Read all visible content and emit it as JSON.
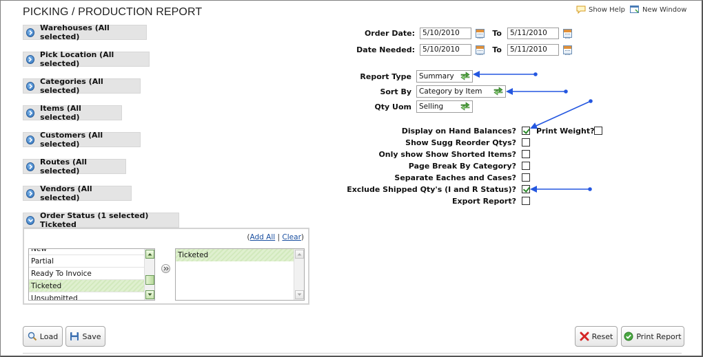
{
  "header": {
    "title": "PICKING / PRODUCTION REPORT",
    "show_help": "Show Help",
    "new_window": "New Window"
  },
  "sections": [
    {
      "label": "Warehouses (All selected)"
    },
    {
      "label": "Pick Location (All selected)"
    },
    {
      "label": "Categories (All selected)"
    },
    {
      "label": "Items (All selected)"
    },
    {
      "label": "Customers (All selected)"
    },
    {
      "label": "Routes (All selected)"
    },
    {
      "label": "Vendors (All selected)"
    },
    {
      "label": "Order Status (1 selected) Ticketed"
    }
  ],
  "order_status": {
    "add_all": "Add All",
    "clear": "Clear",
    "available": [
      "New",
      "Partial",
      "Ready To Invoice",
      "Ticketed",
      "Unsubmitted"
    ],
    "selected": [
      "Ticketed"
    ]
  },
  "dates": {
    "order_date_label": "Order Date:",
    "date_needed_label": "Date Needed:",
    "to_label": "To",
    "order_from": "5/10/2010",
    "order_to": "5/11/2010",
    "needed_from": "5/10/2010",
    "needed_to": "5/11/2010"
  },
  "options": {
    "report_type_label": "Report Type",
    "report_type": "Summary",
    "sort_by_label": "Sort By",
    "sort_by": "Category by Item",
    "qty_uom_label": "Qty Uom",
    "qty_uom": "Selling"
  },
  "checks": {
    "on_hand": {
      "label": "Display on Hand Balances?",
      "checked": true
    },
    "print_weight": {
      "label": "Print Weight?",
      "checked": false
    },
    "sugg_reorder": {
      "label": "Show Sugg Reorder Qtys?",
      "checked": false
    },
    "shorted": {
      "label": "Only show Show Shorted Items?",
      "checked": false
    },
    "page_break": {
      "label": "Page Break By Category?",
      "checked": false
    },
    "separate": {
      "label": "Separate Eaches and Cases?",
      "checked": false
    },
    "exclude_shipped": {
      "label": "Exclude Shipped Qty's (I and R Status)?",
      "checked": true
    },
    "export": {
      "label": "Export Report?",
      "checked": false
    }
  },
  "footer": {
    "load": "Load",
    "save": "Save",
    "reset": "Reset",
    "print": "Print Report"
  },
  "colors": {
    "annotation_arrow": "#2457e0",
    "selected_row": "#d8edc6",
    "section_bg": "#e4e4e4"
  }
}
